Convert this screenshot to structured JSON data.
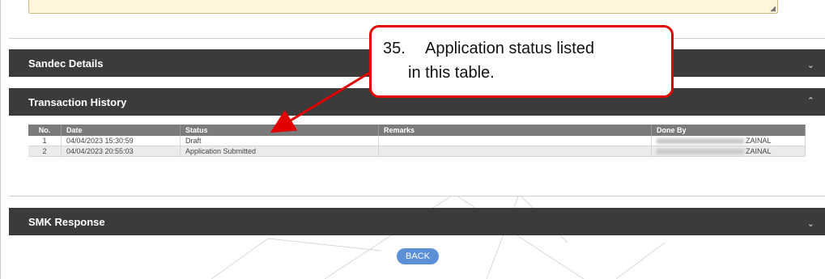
{
  "sections": {
    "sandec_title": "Sandec Details",
    "transaction_title": "Transaction History",
    "smk_title": "SMK Response"
  },
  "icons": {
    "chevron_down": "chevron-down-icon",
    "chevron_up": "chevron-up-icon"
  },
  "table": {
    "headers": {
      "no": "No.",
      "date": "Date",
      "status": "Status",
      "remarks": "Remarks",
      "done_by": "Done By"
    },
    "rows": [
      {
        "no": "1",
        "date": "04/04/2023 15:30:59",
        "status": "Draft",
        "remarks": "",
        "done_by": "ZAINAL"
      },
      {
        "no": "2",
        "date": "04/04/2023 20:55:03",
        "status": "Application Submitted",
        "remarks": "",
        "done_by": "ZAINAL"
      }
    ]
  },
  "back_label": "BACK",
  "callout": {
    "number": "35.",
    "line1": "Application status listed",
    "line2": "in this table."
  },
  "colors": {
    "section_bar": "#3b3b3b",
    "table_header": "#7b7b7b",
    "callout_border": "#e00000",
    "back_button": "#5b8fd6",
    "textarea": "#fdf6dd"
  }
}
